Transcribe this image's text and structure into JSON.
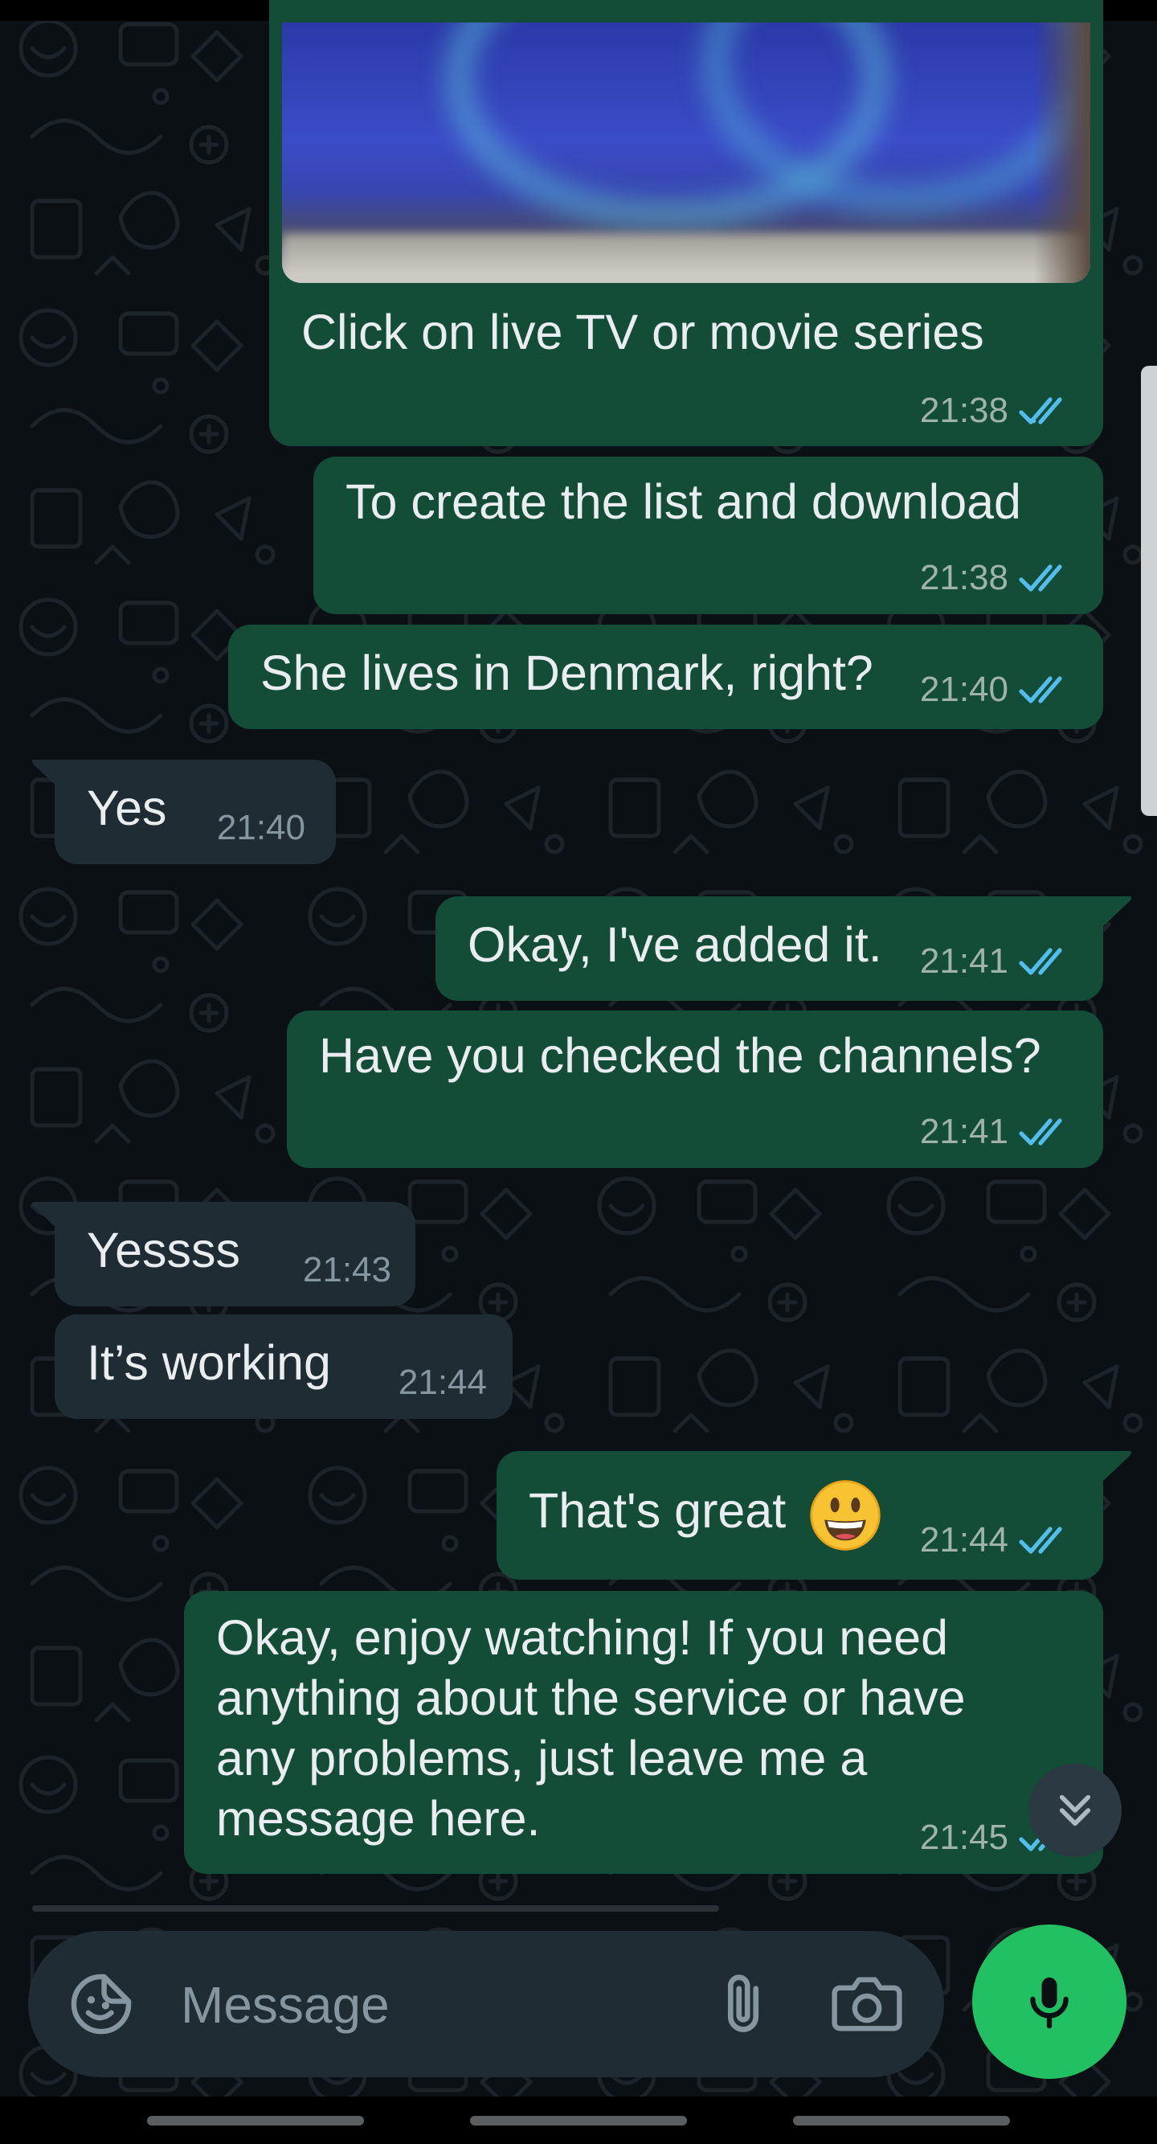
{
  "theme": {
    "background": "#0b1014",
    "outgoing_bubble": "#134d37",
    "incoming_bubble": "#1f2c34",
    "read_tick": "#53bdeb",
    "mic_button": "#21c063"
  },
  "messages": [
    {
      "direction": "outgoing",
      "type": "image",
      "caption": "Click on live TV or movie series",
      "time": "21:38",
      "status": "read"
    },
    {
      "direction": "outgoing",
      "text": "To create the list and download",
      "time": "21:38",
      "status": "read"
    },
    {
      "direction": "outgoing",
      "text": "She lives in Denmark, right?",
      "time": "21:40",
      "status": "read"
    },
    {
      "direction": "incoming",
      "text": "Yes",
      "time": "21:40"
    },
    {
      "direction": "outgoing",
      "text": "Okay, I've added it.",
      "time": "21:41",
      "status": "read"
    },
    {
      "direction": "outgoing",
      "text": "Have you checked the channels?",
      "time": "21:41",
      "status": "read"
    },
    {
      "direction": "incoming",
      "text": "Yessss",
      "time": "21:43"
    },
    {
      "direction": "incoming",
      "text": "It’s working",
      "time": "21:44"
    },
    {
      "direction": "outgoing",
      "text": "That's great",
      "emoji": "grinning-face",
      "time": "21:44",
      "status": "read"
    },
    {
      "direction": "outgoing",
      "lines": [
        "Okay, enjoy watching! If you need",
        "anything about the service or have",
        "any problems, just leave me a",
        "message here."
      ],
      "time": "21:45",
      "status": "read"
    }
  ],
  "composer": {
    "placeholder": "Message",
    "value": "",
    "emoji_icon": "sticker-smiley-icon",
    "attach_icon": "paperclip-icon",
    "camera_icon": "camera-icon",
    "send_icon": "microphone-icon"
  },
  "scroll_down_icon": "double-chevron-down-icon"
}
